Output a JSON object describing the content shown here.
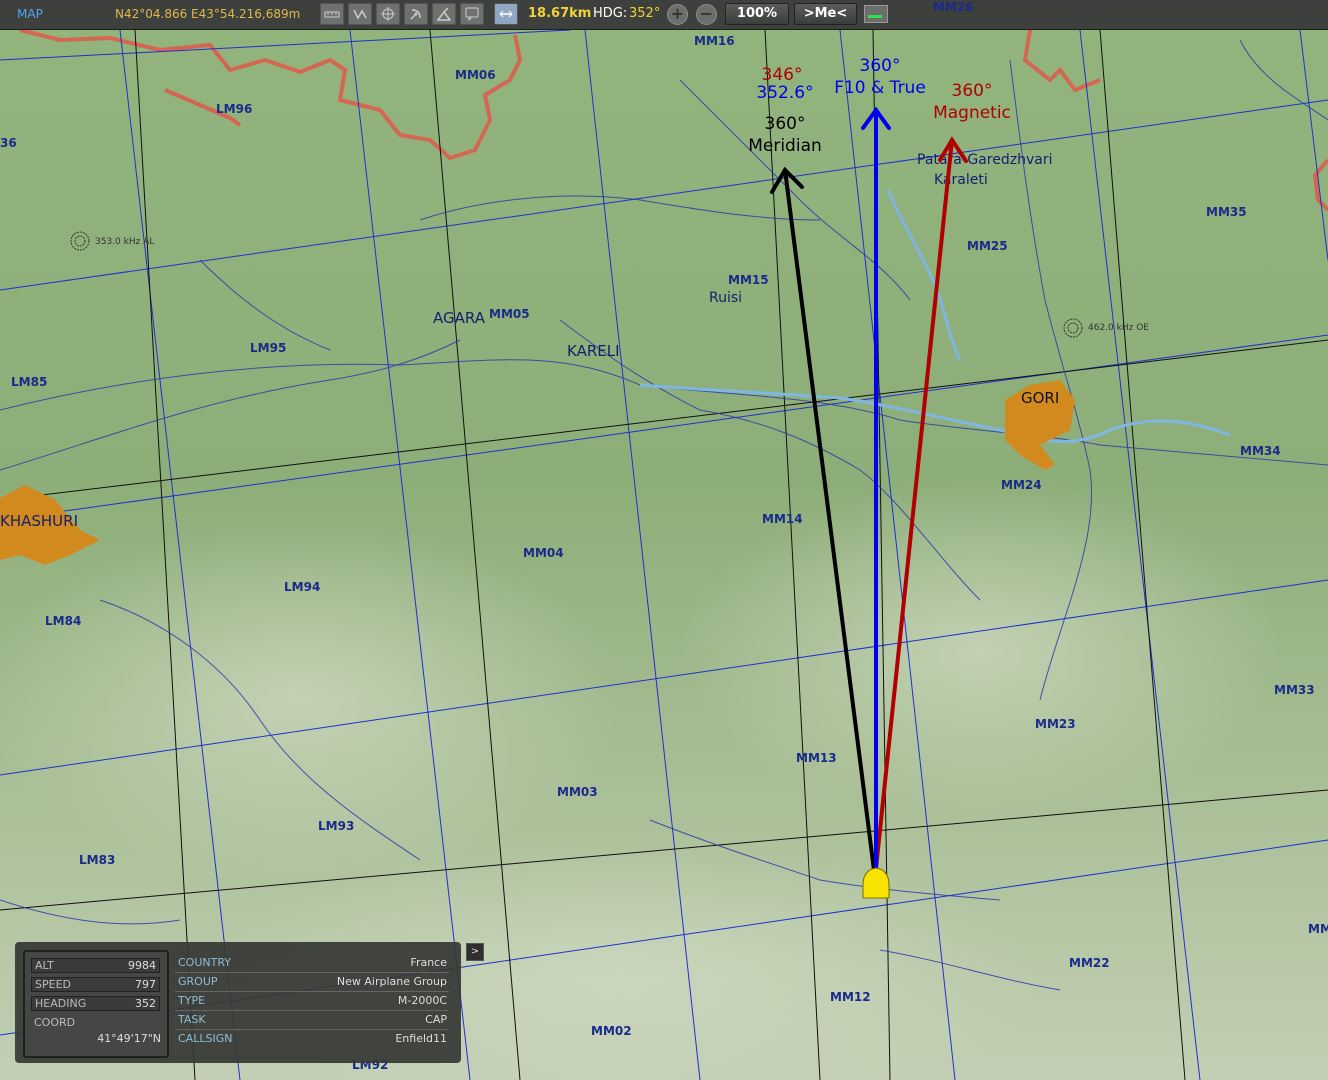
{
  "topbar": {
    "mode": "MAP",
    "coords": "N42°04.866 E43°54.216,689m",
    "distance": "18.67km",
    "hdg_label": "HDG:",
    "hdg_value": "352°",
    "zoom": "100%",
    "me_button": ">Me<",
    "tool_icons": [
      "ruler-icon",
      "route-icon",
      "target-icon",
      "radar-icon",
      "sam-icon",
      "comment-icon",
      "measure-icon"
    ],
    "clipped_label": "MM26"
  },
  "annotations": {
    "meridian_deg": "360°",
    "meridian_label": "Meridian",
    "grid_deg_a": "346°",
    "grid_deg_b": "352.6°",
    "true_deg": "360°",
    "true_label": "F10 & True",
    "mag_deg": "360°",
    "mag_label": "Magnetic"
  },
  "places": {
    "patara": "Patara-Garedzhvari",
    "karaleti": "Karaleti",
    "ruisi": "Ruisi",
    "agara": "AGARA",
    "kareli": "KARELI",
    "gori": "GORI",
    "khashuri": "KHASHURI"
  },
  "navaids": {
    "ndb_al": "353.0 kHz AL",
    "ndb_oe": "462.0 kHz OE"
  },
  "grid_labels": {
    "mm16": "MM16",
    "mm06": "MM06",
    "lm96": "LM96",
    "l36": "36",
    "mm35": "MM35",
    "mm25": "MM25",
    "mm15": "MM15",
    "mm05": "MM05",
    "lm95": "LM95",
    "lm85": "LM85",
    "mm34": "MM34",
    "mm24": "MM24",
    "mm14": "MM14",
    "mm04": "MM04",
    "lm94": "LM94",
    "lm84": "LM84",
    "mm33": "MM33",
    "mm23": "MM23",
    "mm13": "MM13",
    "mm03": "MM03",
    "lm93": "LM93",
    "lm83": "LM83",
    "mm22": "MM22",
    "mm12": "MM12",
    "mm02": "MM02",
    "lm92": "LM92",
    "mm_clip": "MM"
  },
  "stats": {
    "alt_label": "ALT",
    "alt": "9984",
    "speed_label": "SPEED",
    "speed": "797",
    "heading_label": "HEADING",
    "heading": "352",
    "coord_label": "COORD",
    "coord": "41°49'17\"N"
  },
  "info": {
    "country_label": "COUNTRY",
    "country": "France",
    "group_label": "GROUP",
    "group": "New Airplane Group",
    "type_label": "TYPE",
    "type": "M-2000C",
    "task_label": "TASK",
    "task": "CAP",
    "callsign_label": "CALLSIGN",
    "callsign": "Enfield11"
  },
  "expand_button": ">",
  "colors": {
    "true_arrow": "#0000ee",
    "magnetic_arrow": "#b00000",
    "meridian_arrow": "#000000",
    "highlight_text": "#f2d23c",
    "info_label": "#8fbcd4"
  }
}
